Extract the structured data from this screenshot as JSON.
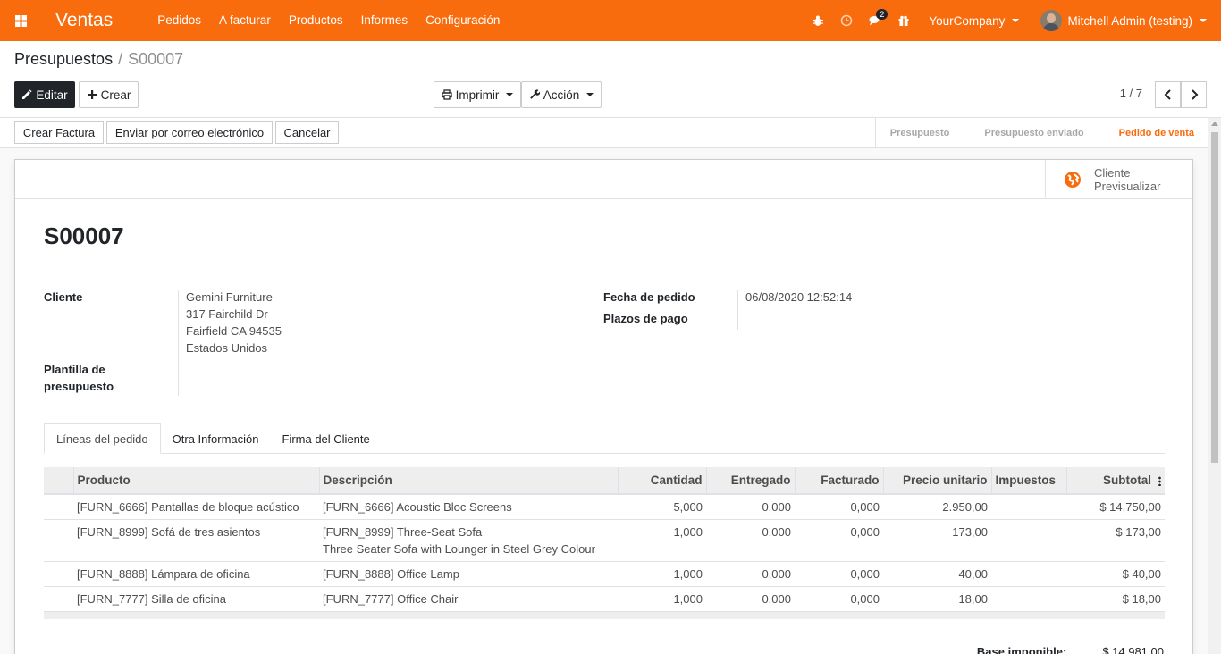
{
  "navbar": {
    "app_name": "Ventas",
    "menu": [
      "Pedidos",
      "A facturar",
      "Productos",
      "Informes",
      "Configuración"
    ],
    "messages_count": "2",
    "company": "YourCompany",
    "user": "Mitchell Admin (testing)",
    "color": "#f86c0d"
  },
  "breadcrumb": {
    "parent": "Presupuestos",
    "separator": "/",
    "current": "S00007"
  },
  "toolbar": {
    "edit_label": "Editar",
    "create_label": "Crear",
    "print_label": "Imprimir",
    "action_label": "Acción",
    "pager": "1 / 7"
  },
  "statusbar": {
    "buttons": [
      "Crear Factura",
      "Enviar por correo electrónico",
      "Cancelar"
    ],
    "stages": [
      {
        "label": "Presupuesto",
        "active": false
      },
      {
        "label": "Presupuesto enviado",
        "active": false
      },
      {
        "label": "Pedido de venta",
        "active": true
      }
    ]
  },
  "sheet": {
    "preview_line1": "Cliente",
    "preview_line2": "Previsualizar",
    "title": "S00007",
    "customer_label": "Cliente",
    "customer_name": "Gemini Furniture",
    "customer_address": [
      "317 Fairchild Dr",
      "Fairfield CA 94535",
      "Estados Unidos"
    ],
    "template_label_1": "Plantilla de",
    "template_label_2": "presupuesto",
    "order_date_label": "Fecha de pedido",
    "order_date_value": "06/08/2020 12:52:14",
    "payment_terms_label": "Plazos de pago",
    "tabs": [
      "Líneas del pedido",
      "Otra Información",
      "Firma del Cliente"
    ]
  },
  "lines": {
    "headers": [
      "Producto",
      "Descripción",
      "Cantidad",
      "Entregado",
      "Facturado",
      "Precio unitario",
      "Impuestos",
      "Subtotal"
    ],
    "rows": [
      {
        "product": "[FURN_6666] Pantallas de bloque acústico",
        "description": "[FURN_6666] Acoustic Bloc Screens",
        "description2": "",
        "qty": "5,000",
        "delivered": "0,000",
        "invoiced": "0,000",
        "price": "2.950,00",
        "taxes": "",
        "subtotal": "$ 14.750,00"
      },
      {
        "product": "[FURN_8999] Sofá de tres asientos",
        "description": "[FURN_8999] Three-Seat Sofa",
        "description2": "Three Seater Sofa with Lounger in Steel Grey Colour",
        "qty": "1,000",
        "delivered": "0,000",
        "invoiced": "0,000",
        "price": "173,00",
        "taxes": "",
        "subtotal": "$ 173,00"
      },
      {
        "product": "[FURN_8888] Lámpara de oficina",
        "description": "[FURN_8888] Office Lamp",
        "description2": "",
        "qty": "1,000",
        "delivered": "0,000",
        "invoiced": "0,000",
        "price": "40,00",
        "taxes": "",
        "subtotal": "$ 40,00"
      },
      {
        "product": "[FURN_7777] Silla de oficina",
        "description": "[FURN_7777] Office Chair",
        "description2": "",
        "qty": "1,000",
        "delivered": "0,000",
        "invoiced": "0,000",
        "price": "18,00",
        "taxes": "",
        "subtotal": "$ 18,00"
      }
    ]
  },
  "totals": {
    "untaxed_label": "Base imponible:",
    "untaxed_value": "$ 14.981,00"
  }
}
